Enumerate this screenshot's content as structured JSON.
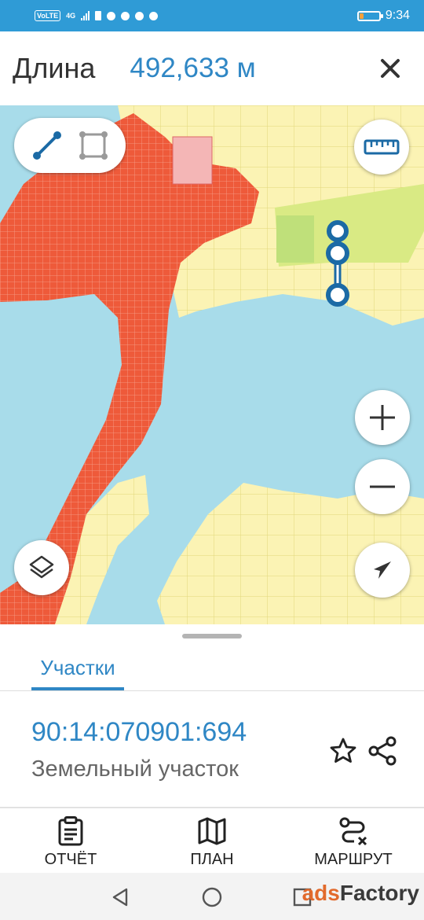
{
  "status_bar": {
    "network_badge": "VoLTE",
    "network_type": "4G",
    "time": "9:34",
    "battery_level_percent": 20,
    "battery_color": "#f4a13c",
    "icons": [
      "signal-icon",
      "sim-icon",
      "social-app-icon",
      "social-app-icon",
      "facebook-icon",
      "whatsapp-icon"
    ]
  },
  "header": {
    "label": "Длина",
    "value": "492,633 м",
    "close_icon": "close-icon"
  },
  "map": {
    "mode_toggle": [
      "line-measure-icon",
      "area-measure-icon"
    ],
    "ruler_icon": "ruler-icon",
    "zoom_in_icon": "plus-icon",
    "zoom_out_icon": "minus-icon",
    "location_icon": "navigation-arrow-icon",
    "layers_icon": "layers-icon",
    "colors": {
      "water": "#a8dcea",
      "land": "#fbf3b4",
      "urban": "#ee5a3a",
      "measure": "#1b6aa5"
    }
  },
  "sheet": {
    "tab_label": "Участки",
    "parcel_id": "90:14:070901:694",
    "parcel_type": "Земельный участок",
    "star_icon": "star-icon",
    "share_icon": "share-icon"
  },
  "actions": [
    {
      "label": "ОТЧЁТ",
      "icon": "clipboard-icon"
    },
    {
      "label": "ПЛАН",
      "icon": "map-icon"
    },
    {
      "label": "МАРШРУТ",
      "icon": "route-icon"
    }
  ],
  "navbar": {
    "back_icon": "back-icon",
    "home_icon": "home-icon",
    "recents_icon": "recents-icon",
    "watermark_part1": "ads",
    "watermark_part2": "Factory"
  },
  "colors": {
    "accent": "#2f87c5",
    "status_bar": "#2f9bd6"
  }
}
